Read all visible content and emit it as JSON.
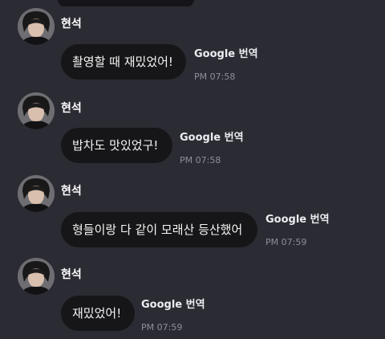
{
  "messages": [
    {
      "sender": "현석",
      "text": "촬영할 때 재밌었어!",
      "translate_label": "Google 번역",
      "time": "PM 07:58",
      "avatar_icon": "profile-photo-icon"
    },
    {
      "sender": "현석",
      "text": "밥차도 맛있었구!",
      "translate_label": "Google 번역",
      "time": "PM 07:58",
      "avatar_icon": "profile-photo-icon"
    },
    {
      "sender": "현석",
      "text": "형들이랑 다 같이 모래산 등산했어",
      "translate_label": "Google 번역",
      "time": "PM 07:59",
      "avatar_icon": "profile-photo-icon"
    },
    {
      "sender": "현석",
      "text": "재밌었어!",
      "translate_label": "Google 번역",
      "time": "PM 07:59",
      "avatar_icon": "profile-photo-icon"
    }
  ],
  "colors": {
    "background": "#2b2b34",
    "bubble": "#161618",
    "text": "#f4f4f4",
    "time": "#8e8e98"
  }
}
